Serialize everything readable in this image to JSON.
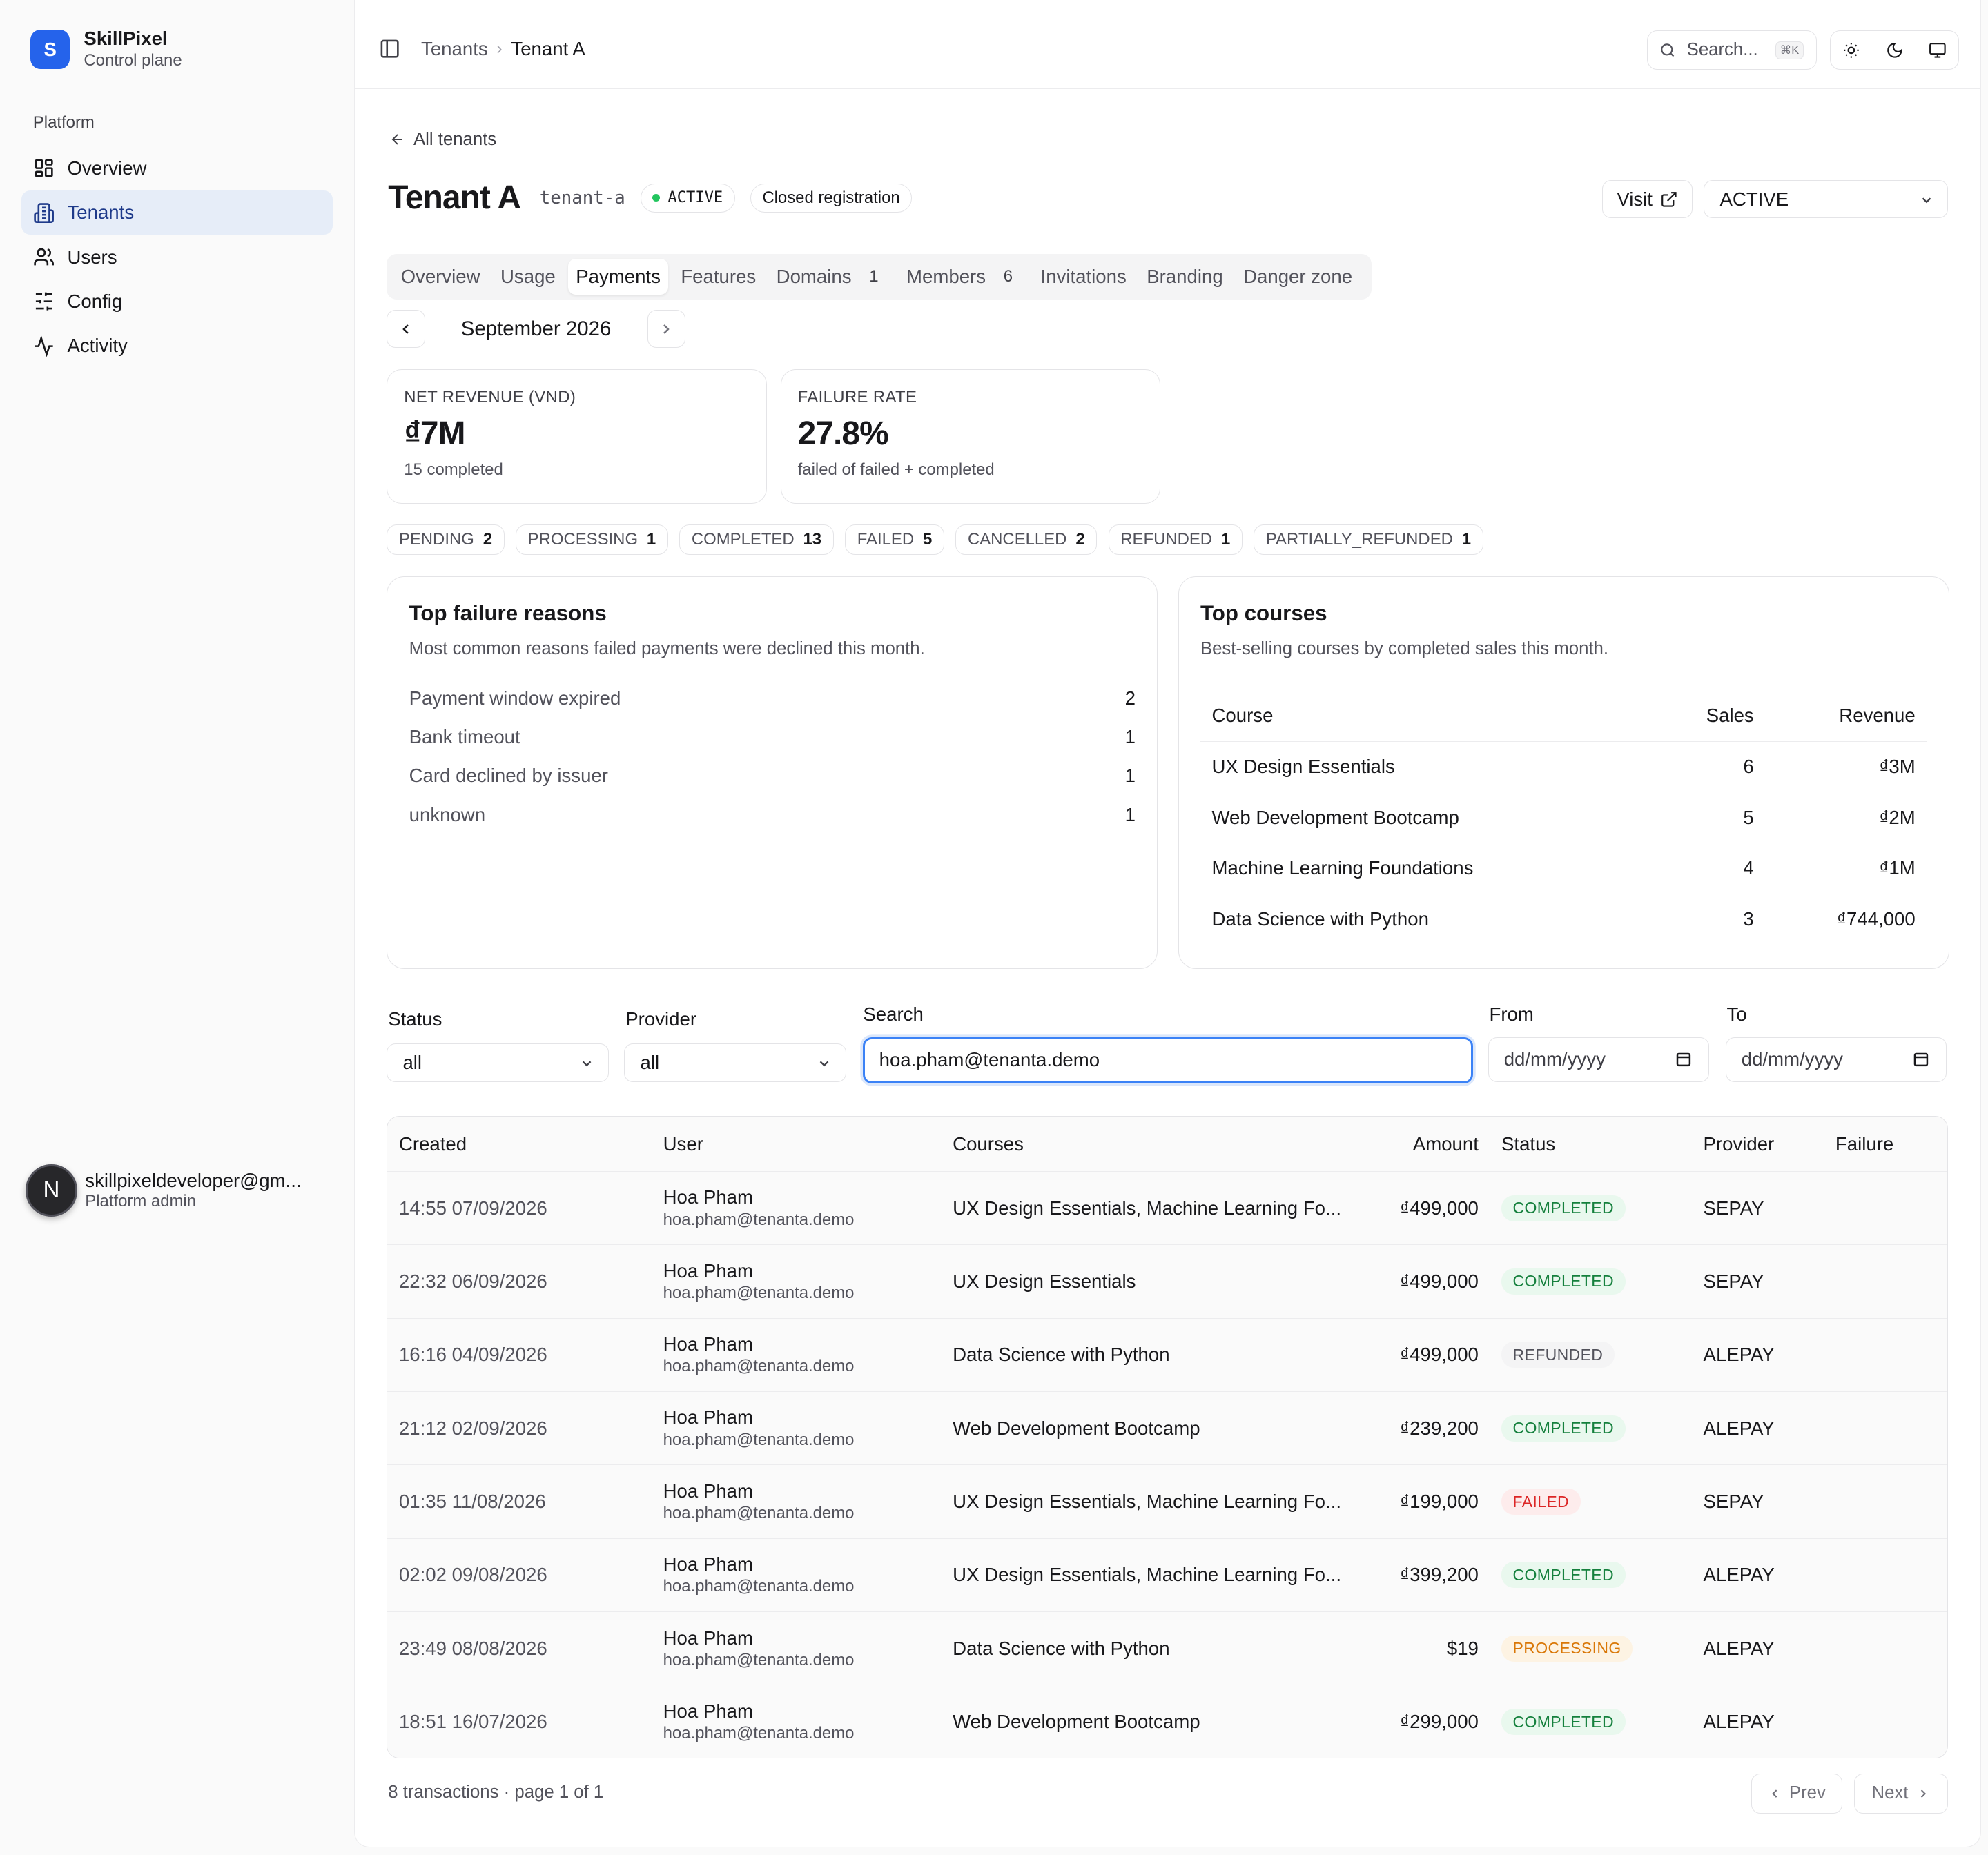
{
  "brand": {
    "initial": "S",
    "name": "SkillPixel",
    "subtitle": "Control plane"
  },
  "sidebar": {
    "group_label": "Platform",
    "items": [
      {
        "label": "Overview",
        "icon": "layout-grid-icon",
        "active": false
      },
      {
        "label": "Tenants",
        "icon": "building-icon",
        "active": true
      },
      {
        "label": "Users",
        "icon": "users-icon",
        "active": false
      },
      {
        "label": "Config",
        "icon": "sliders-icon",
        "active": false
      },
      {
        "label": "Activity",
        "icon": "activity-icon",
        "active": false
      }
    ],
    "user": {
      "initial": "N",
      "email": "skillpixeldeveloper@gm...",
      "role": "Platform admin"
    }
  },
  "topbar": {
    "breadcrumb": {
      "parent": "Tenants",
      "current": "Tenant A"
    },
    "search_placeholder": "Search...",
    "shortcut": "⌘K"
  },
  "header": {
    "back_label": "All tenants",
    "title": "Tenant A",
    "slug": "tenant-a",
    "status_badge": "ACTIVE",
    "registration_badge": "Closed registration",
    "visit_label": "Visit",
    "status_select": "ACTIVE"
  },
  "tabs": [
    {
      "label": "Overview",
      "count": ""
    },
    {
      "label": "Usage",
      "count": ""
    },
    {
      "label": "Payments",
      "count": "",
      "active": true
    },
    {
      "label": "Features",
      "count": ""
    },
    {
      "label": "Domains",
      "count": "1"
    },
    {
      "label": "Members",
      "count": "6"
    },
    {
      "label": "Invitations",
      "count": ""
    },
    {
      "label": "Branding",
      "count": ""
    },
    {
      "label": "Danger zone",
      "count": ""
    }
  ],
  "month": "September 2026",
  "stats": {
    "revenue": {
      "label": "NET REVENUE (VND)",
      "value": "₫7M",
      "sub": "15 completed"
    },
    "failure": {
      "label": "FAILURE RATE",
      "value": "27.8%",
      "sub": "failed of failed + completed"
    }
  },
  "status_chips": [
    {
      "label": "PENDING",
      "count": "2"
    },
    {
      "label": "PROCESSING",
      "count": "1"
    },
    {
      "label": "COMPLETED",
      "count": "13"
    },
    {
      "label": "FAILED",
      "count": "5"
    },
    {
      "label": "CANCELLED",
      "count": "2"
    },
    {
      "label": "REFUNDED",
      "count": "1"
    },
    {
      "label": "PARTIALLY_REFUNDED",
      "count": "1"
    }
  ],
  "failure_reasons": {
    "title": "Top failure reasons",
    "description": "Most common reasons failed payments were declined this month.",
    "items": [
      {
        "reason": "Payment window expired",
        "count": "2"
      },
      {
        "reason": "Bank timeout",
        "count": "1"
      },
      {
        "reason": "Card declined by issuer",
        "count": "1"
      },
      {
        "reason": "unknown",
        "count": "1"
      }
    ]
  },
  "top_courses": {
    "title": "Top courses",
    "description": "Best-selling courses by completed sales this month.",
    "headers": {
      "course": "Course",
      "sales": "Sales",
      "revenue": "Revenue"
    },
    "rows": [
      {
        "course": "UX Design Essentials",
        "sales": "6",
        "revenue": "₫3M"
      },
      {
        "course": "Web Development Bootcamp",
        "sales": "5",
        "revenue": "₫2M"
      },
      {
        "course": "Machine Learning Foundations",
        "sales": "4",
        "revenue": "₫1M"
      },
      {
        "course": "Data Science with Python",
        "sales": "3",
        "revenue": "₫744,000"
      }
    ]
  },
  "filters": {
    "status_label": "Status",
    "status_value": "all",
    "provider_label": "Provider",
    "provider_value": "all",
    "search_label": "Search",
    "search_value": "hoa.pham@tenanta.demo",
    "from_label": "From",
    "from_placeholder": "dd/mm/yyyy",
    "to_label": "To",
    "to_placeholder": "dd/mm/yyyy"
  },
  "transactions": {
    "headers": {
      "created": "Created",
      "user": "User",
      "courses": "Courses",
      "amount": "Amount",
      "status": "Status",
      "provider": "Provider",
      "failure": "Failure"
    },
    "rows": [
      {
        "created": "14:55 07/09/2026",
        "name": "Hoa Pham",
        "email": "hoa.pham@tenanta.demo",
        "courses": "UX Design Essentials, Machine Learning Fo...",
        "amount": "₫499,000",
        "status": "COMPLETED",
        "status_class": "completed",
        "provider": "SEPAY",
        "failure": ""
      },
      {
        "created": "22:32 06/09/2026",
        "name": "Hoa Pham",
        "email": "hoa.pham@tenanta.demo",
        "courses": "UX Design Essentials",
        "amount": "₫499,000",
        "status": "COMPLETED",
        "status_class": "completed",
        "provider": "SEPAY",
        "failure": ""
      },
      {
        "created": "16:16 04/09/2026",
        "name": "Hoa Pham",
        "email": "hoa.pham@tenanta.demo",
        "courses": "Data Science with Python",
        "amount": "₫499,000",
        "status": "REFUNDED",
        "status_class": "refunded",
        "provider": "ALEPAY",
        "failure": ""
      },
      {
        "created": "21:12 02/09/2026",
        "name": "Hoa Pham",
        "email": "hoa.pham@tenanta.demo",
        "courses": "Web Development Bootcamp",
        "amount": "₫239,200",
        "status": "COMPLETED",
        "status_class": "completed",
        "provider": "ALEPAY",
        "failure": ""
      },
      {
        "created": "01:35 11/08/2026",
        "name": "Hoa Pham",
        "email": "hoa.pham@tenanta.demo",
        "courses": "UX Design Essentials, Machine Learning Fo...",
        "amount": "₫199,000",
        "status": "FAILED",
        "status_class": "failed",
        "provider": "SEPAY",
        "failure": ""
      },
      {
        "created": "02:02 09/08/2026",
        "name": "Hoa Pham",
        "email": "hoa.pham@tenanta.demo",
        "courses": "UX Design Essentials, Machine Learning Fo...",
        "amount": "₫399,200",
        "status": "COMPLETED",
        "status_class": "completed",
        "provider": "ALEPAY",
        "failure": ""
      },
      {
        "created": "23:49 08/08/2026",
        "name": "Hoa Pham",
        "email": "hoa.pham@tenanta.demo",
        "courses": "Data Science with Python",
        "amount": "$19",
        "status": "PROCESSING",
        "status_class": "processing",
        "provider": "ALEPAY",
        "failure": ""
      },
      {
        "created": "18:51 16/07/2026",
        "name": "Hoa Pham",
        "email": "hoa.pham@tenanta.demo",
        "courses": "Web Development Bootcamp",
        "amount": "₫299,000",
        "status": "COMPLETED",
        "status_class": "completed",
        "provider": "ALEPAY",
        "failure": ""
      }
    ],
    "summary": "8 transactions · page 1 of 1",
    "prev_label": "Prev",
    "next_label": "Next"
  }
}
